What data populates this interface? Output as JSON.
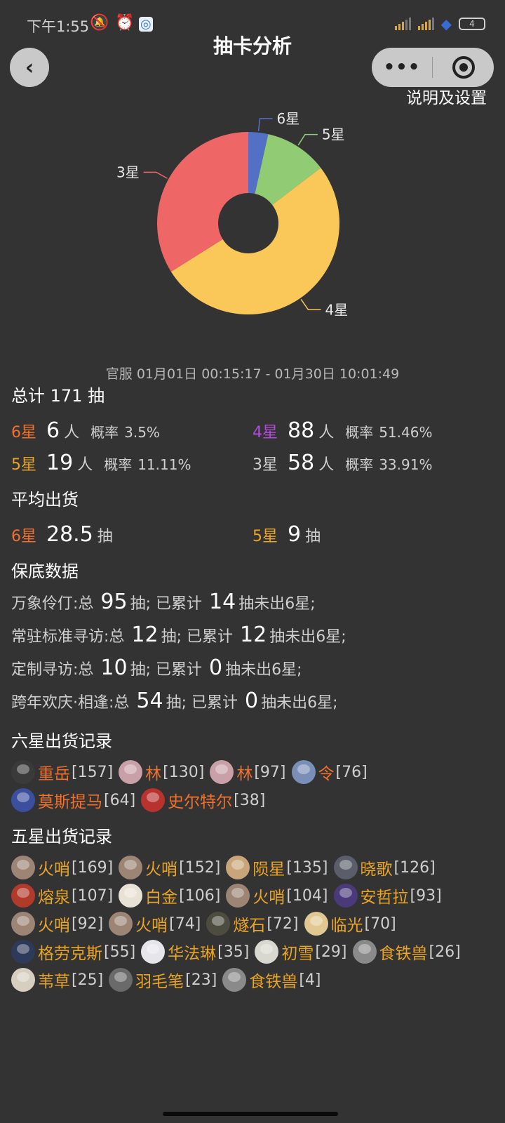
{
  "status_bar": {
    "time": "下午1:55",
    "battery": "4"
  },
  "nav": {
    "title": "抽卡分析",
    "settings_link": "说明及设置"
  },
  "colors": {
    "six": "#f0702d",
    "five": "#e8a427",
    "four": "#b24bd8",
    "three": "#cfcfcf"
  },
  "chart_data": {
    "type": "pie",
    "donut": true,
    "labels": [
      "6星",
      "5星",
      "4星",
      "3星"
    ],
    "values": [
      6,
      19,
      88,
      58
    ],
    "colors": [
      "#5470c6",
      "#91cc75",
      "#fac858",
      "#ee6666"
    ]
  },
  "date_range": "官服 01月01日 00:15:17 - 01月30日 10:01:49",
  "summary": {
    "title": "总计 171 抽",
    "rows": [
      [
        {
          "label": "6星",
          "count": "6",
          "unit": "人",
          "prob_label": "概率",
          "prob": "3.5%",
          "tone": "six"
        },
        {
          "label": "4星",
          "count": "88",
          "unit": "人",
          "prob_label": "概率",
          "prob": "51.46%",
          "tone": "four"
        }
      ],
      [
        {
          "label": "5星",
          "count": "19",
          "unit": "人",
          "prob_label": "概率",
          "prob": "11.11%",
          "tone": "five"
        },
        {
          "label": "3星",
          "count": "58",
          "unit": "人",
          "prob_label": "概率",
          "prob": "33.91%",
          "tone": "three"
        }
      ]
    ]
  },
  "average": {
    "title": "平均出货",
    "items": [
      {
        "label": "6星",
        "value": "28.5",
        "unit": "抽",
        "tone": "six"
      },
      {
        "label": "5星",
        "value": "9",
        "unit": "抽",
        "tone": "five"
      }
    ]
  },
  "pity": {
    "title": "保底数据",
    "rows": [
      {
        "pool": "万象伶仃:总",
        "total": "95",
        "mid": "抽; 已累计",
        "since": "14",
        "tail": "抽未出6星;"
      },
      {
        "pool": "常驻标准寻访:总",
        "total": "12",
        "mid": "抽; 已累计",
        "since": "12",
        "tail": "抽未出6星;"
      },
      {
        "pool": "定制寻访:总",
        "total": "10",
        "mid": "抽; 已累计",
        "since": "0",
        "tail": "抽未出6星;"
      },
      {
        "pool": "跨年欢庆·相逢:总",
        "total": "54",
        "mid": "抽; 已累计",
        "since": "0",
        "tail": "抽未出6星;"
      }
    ]
  },
  "six_star_records": {
    "title": "六星出货记录",
    "items": [
      {
        "name": "重岳",
        "count": "[157]",
        "avatar": "#3a3a3a"
      },
      {
        "name": "林",
        "count": "[130]",
        "avatar": "#c9a0a8"
      },
      {
        "name": "林",
        "count": "[97]",
        "avatar": "#c9a0a8"
      },
      {
        "name": "令",
        "count": "[76]",
        "avatar": "#7a8fb8"
      },
      {
        "name": "莫斯提马",
        "count": "[64]",
        "avatar": "#3b4f9e"
      },
      {
        "name": "史尔特尔",
        "count": "[38]",
        "avatar": "#b8322e"
      }
    ]
  },
  "five_star_records": {
    "title": "五星出货记录",
    "items": [
      {
        "name": "火哨",
        "count": "[169]",
        "avatar": "#9c8575"
      },
      {
        "name": "火哨",
        "count": "[152]",
        "avatar": "#9c8575"
      },
      {
        "name": "陨星",
        "count": "[135]",
        "avatar": "#c8a67a"
      },
      {
        "name": "晓歌",
        "count": "[126]",
        "avatar": "#5b5e6a"
      },
      {
        "name": "熔泉",
        "count": "[107]",
        "avatar": "#b23a2a"
      },
      {
        "name": "白金",
        "count": "[106]",
        "avatar": "#e8e2d6"
      },
      {
        "name": "火哨",
        "count": "[104]",
        "avatar": "#9c8575"
      },
      {
        "name": "安哲拉",
        "count": "[93]",
        "avatar": "#4a3a7a"
      },
      {
        "name": "火哨",
        "count": "[92]",
        "avatar": "#9c8575"
      },
      {
        "name": "火哨",
        "count": "[74]",
        "avatar": "#9c8575"
      },
      {
        "name": "燧石",
        "count": "[72]",
        "avatar": "#4d4d3f"
      },
      {
        "name": "临光",
        "count": "[70]",
        "avatar": "#e0c890"
      },
      {
        "name": "格劳克斯",
        "count": "[55]",
        "avatar": "#2e3a5a"
      },
      {
        "name": "华法琳",
        "count": "[35]",
        "avatar": "#e6e6ea"
      },
      {
        "name": "初雪",
        "count": "[29]",
        "avatar": "#d8d8d0"
      },
      {
        "name": "食铁兽",
        "count": "[26]",
        "avatar": "#8a8a8a"
      },
      {
        "name": "苇草",
        "count": "[25]",
        "avatar": "#d6cfc0"
      },
      {
        "name": "羽毛笔",
        "count": "[23]",
        "avatar": "#6a6a6a"
      },
      {
        "name": "食铁兽",
        "count": "[4]",
        "avatar": "#8a8a8a"
      }
    ]
  }
}
